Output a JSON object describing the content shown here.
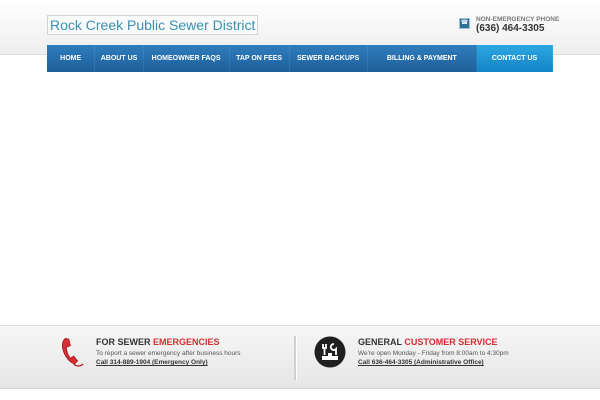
{
  "header": {
    "title": "Rock Creek Public Sewer District",
    "phone_label": "NON-EMERGENCY PHONE",
    "phone_number": "(636) 464-3305"
  },
  "nav": {
    "items": [
      {
        "label": "HOME"
      },
      {
        "label": "ABOUT US"
      },
      {
        "label": "HOMEOWNER FAQS"
      },
      {
        "label": "TAP ON FEES"
      },
      {
        "label": "SEWER BACKUPS"
      },
      {
        "label": "BILLING & PAYMENT"
      },
      {
        "label": "CONTACT US"
      }
    ],
    "active": "CONTACT US"
  },
  "footer": {
    "left": {
      "title_pre": "FOR SEWER",
      "title_accent": "EMERGENCIES",
      "desc": "To report a sewer emergency after business hours",
      "call": "Call 314-889-1904 (Emergency Only)",
      "icon": "phone-icon"
    },
    "right": {
      "title_pre": "GENERAL",
      "title_accent": "CUSTOMER SERVICE",
      "desc": "We're open Monday - Friday from 8:00am to 4:30pm",
      "call": "Call 636-464-3305 (Administrative Office)",
      "icon": "tools-icon"
    }
  },
  "colors": {
    "nav_blue": "#2f7dbd",
    "nav_active": "#1e97d9",
    "accent_red": "#d62e33",
    "logo_text": "#3b8fb0"
  }
}
